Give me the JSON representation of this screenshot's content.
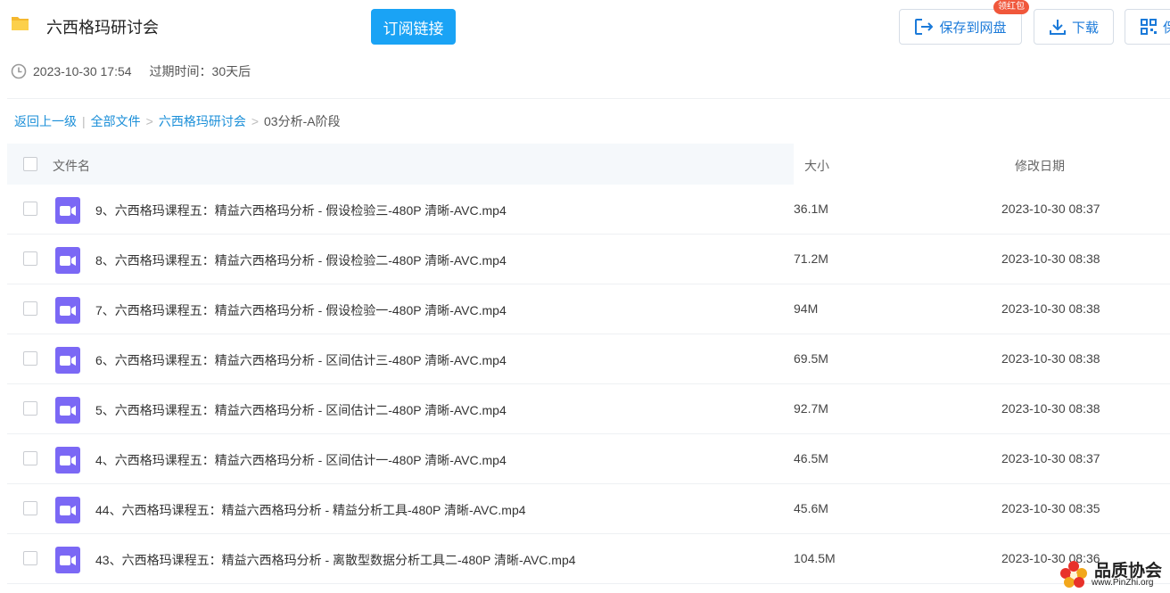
{
  "header": {
    "title": "六西格玛研讨会",
    "subscribe_label": "订阅链接",
    "save_label": "保存到网盘",
    "download_label": "下载",
    "more_label": "保",
    "badge": "领红包"
  },
  "meta": {
    "datetime": "2023-10-30 17:54",
    "expire": "过期时间：30天后"
  },
  "breadcrumb": {
    "back": "返回上一级",
    "sep_bar": "|",
    "all_files": "全部文件",
    "sep1": ">",
    "folder": "六西格玛研讨会",
    "sep2": ">",
    "current": "03分析-A阶段"
  },
  "table": {
    "headers": {
      "name": "文件名",
      "size": "大小",
      "date": "修改日期"
    },
    "rows": [
      {
        "name": "9、六西格玛课程五：精益六西格玛分析 - 假设检验三-480P 清晰-AVC.mp4",
        "size": "36.1M",
        "date": "2023-10-30 08:37"
      },
      {
        "name": "8、六西格玛课程五：精益六西格玛分析 - 假设检验二-480P 清晰-AVC.mp4",
        "size": "71.2M",
        "date": "2023-10-30 08:38"
      },
      {
        "name": "7、六西格玛课程五：精益六西格玛分析 - 假设检验一-480P 清晰-AVC.mp4",
        "size": "94M",
        "date": "2023-10-30 08:38"
      },
      {
        "name": "6、六西格玛课程五：精益六西格玛分析 - 区间估计三-480P 清晰-AVC.mp4",
        "size": "69.5M",
        "date": "2023-10-30 08:38"
      },
      {
        "name": "5、六西格玛课程五：精益六西格玛分析 - 区间估计二-480P 清晰-AVC.mp4",
        "size": "92.7M",
        "date": "2023-10-30 08:38"
      },
      {
        "name": "4、六西格玛课程五：精益六西格玛分析 - 区间估计一-480P 清晰-AVC.mp4",
        "size": "46.5M",
        "date": "2023-10-30 08:37"
      },
      {
        "name": "44、六西格玛课程五：精益六西格玛分析 - 精益分析工具-480P 清晰-AVC.mp4",
        "size": "45.6M",
        "date": "2023-10-30 08:35"
      },
      {
        "name": "43、六西格玛课程五：精益六西格玛分析 - 离散型数据分析工具二-480P 清晰-AVC.mp4",
        "size": "104.5M",
        "date": "2023-10-30 08:36"
      }
    ]
  },
  "watermark": {
    "title": "品质协会",
    "url": "www.PinZhi.org"
  },
  "colors": {
    "accent": "#1aa3f5",
    "link": "#1b8fd8",
    "video_icon": "#7b68f5",
    "badge": "#f0573b"
  },
  "icons": [
    "folder-icon",
    "save-to-disk-icon",
    "download-icon",
    "qr-icon",
    "clock-icon",
    "video-file-icon"
  ]
}
